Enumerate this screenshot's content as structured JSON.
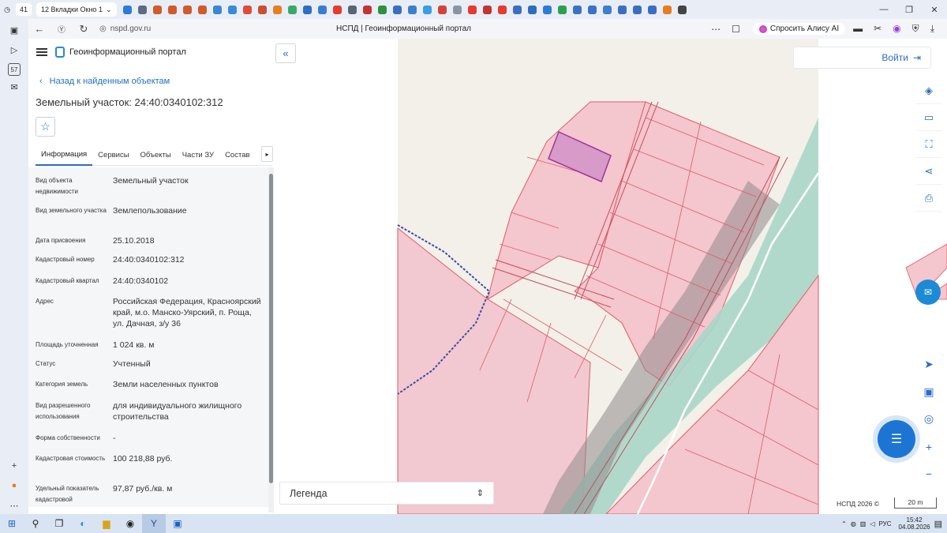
{
  "browser": {
    "tab_count": "41",
    "tab_group_label": "12 Вкладки Окно 1",
    "url": "nspd.gov.ru",
    "page_title": "НСПД | Геоинформационный портал",
    "alice_label": "Спросить Алису AI"
  },
  "favorites": [
    {
      "icon": "vk-icon",
      "color": "#2f7ad9"
    },
    {
      "icon": "bookmark-icon",
      "color": "#5b6b82"
    },
    {
      "icon": "emblem-icon",
      "color": "#d05a2a"
    },
    {
      "icon": "emblem-icon",
      "color": "#d05a2a"
    },
    {
      "icon": "emblem-icon",
      "color": "#d05a2a"
    },
    {
      "icon": "emblem-icon",
      "color": "#d05a2a"
    },
    {
      "icon": "cube-icon",
      "color": "#3a86d0"
    },
    {
      "icon": "globe-icon",
      "color": "#3a8bd6"
    },
    {
      "icon": "umbrella-icon",
      "color": "#e04a3b"
    },
    {
      "icon": "house-icon",
      "color": "#c7502e"
    },
    {
      "icon": "search-icon",
      "color": "#e57e22"
    },
    {
      "icon": "gear-icon",
      "color": "#3aa86b"
    },
    {
      "icon": "gosuslugi-icon",
      "color": "#2e6ec5"
    },
    {
      "icon": "document-icon",
      "color": "#3a7bd5"
    },
    {
      "icon": "yandex-icon",
      "color": "#e33b2e"
    },
    {
      "icon": "file-icon",
      "color": "#5a6574"
    },
    {
      "icon": "flag-icon",
      "color": "#c23434"
    },
    {
      "icon": "terminal-icon",
      "color": "#2f8f3a"
    },
    {
      "icon": "emblem-icon",
      "color": "#3a6fc0"
    },
    {
      "icon": "globe-icon",
      "color": "#3d7fc8"
    },
    {
      "icon": "cloud-icon",
      "color": "#3b9ee3"
    },
    {
      "icon": "pdf-icon",
      "color": "#d0453a"
    },
    {
      "icon": "file-icon",
      "color": "#8a95a3"
    },
    {
      "icon": "yandex-icon",
      "color": "#e33b2e"
    },
    {
      "icon": "flag-icon",
      "color": "#c23434"
    },
    {
      "icon": "yandex-icon",
      "color": "#e33b2e"
    },
    {
      "icon": "emblem-icon",
      "color": "#3a6fc0"
    },
    {
      "icon": "download-icon",
      "color": "#2c6fb8"
    },
    {
      "icon": "vk-icon",
      "color": "#2f7ad9"
    },
    {
      "icon": "loading-icon",
      "color": "#2da04f"
    },
    {
      "icon": "search-icon",
      "color": "#3a73c4"
    },
    {
      "icon": "search-icon",
      "color": "#3a73c4"
    },
    {
      "icon": "globe-icon",
      "color": "#3d7fc8"
    },
    {
      "icon": "emblem-icon",
      "color": "#3a6fc0"
    },
    {
      "icon": "emblem-icon",
      "color": "#3a6fc0"
    },
    {
      "icon": "emblem-icon",
      "color": "#3a6fc0"
    },
    {
      "icon": "mail-icon",
      "color": "#e57e22"
    },
    {
      "icon": "plus-icon",
      "color": "#444444"
    }
  ],
  "app": {
    "portal_name": "Геоинформационный портал",
    "back_link": "Назад к найденным объектам",
    "object_title": "Земельный участок: 24:40:0340102:312",
    "tabs": [
      "Информация",
      "Сервисы",
      "Объекты",
      "Части ЗУ",
      "Состав"
    ],
    "active_tab": "Информация",
    "properties": [
      {
        "label": "Вид объекта недвижимости",
        "value": "Земельный участок"
      },
      {
        "label": "Вид земельного участка",
        "value": "Землепользование"
      },
      {
        "label": "Дата присвоения",
        "value": "25.10.2018"
      },
      {
        "label": "Кадастровый номер",
        "value": "24:40:0340102:312"
      },
      {
        "label": "Кадастровый квартал",
        "value": "24:40:0340102"
      },
      {
        "label": "Адрес",
        "value": "Российская Федерация, Красноярский край, м.о. Манско-Уярский, п. Роща, ул. Дачная, з/у 36"
      },
      {
        "label": "Площадь уточненная",
        "value": "1 024 кв. м"
      },
      {
        "label": "Статус",
        "value": "Учтенный"
      },
      {
        "label": "Категория земель",
        "value": "Земли населенных пунктов"
      },
      {
        "label": "Вид разрешенного использования",
        "value": "для индивидуального жилищного строительства"
      },
      {
        "label": "Форма собственности",
        "value": "-"
      },
      {
        "label": "Кадастровая стоимость",
        "value": "100 218,88 руб."
      },
      {
        "label": "Удельный показатель кадастровой",
        "value": "97,87 руб./кв. м"
      }
    ],
    "legend_label": "Легенда",
    "login_label": "Войти",
    "copyright": "НСПД 2026 ©",
    "scale_label": "20 m"
  },
  "map_colors": {
    "parcel_fill": "#f4c6ce",
    "parcel_stroke": "#e25a6a",
    "selected_fill": "#d79ac9",
    "selected_stroke": "#a0359a",
    "zone_green": "#a9d6c9",
    "shadow_band": "#9e9b9b",
    "background_beige": "#f2f0e9",
    "boundary_blue": "#3a49a8"
  },
  "taskbar": {
    "lang": "РУС",
    "time": "15:42",
    "date": "04.08.2026"
  }
}
